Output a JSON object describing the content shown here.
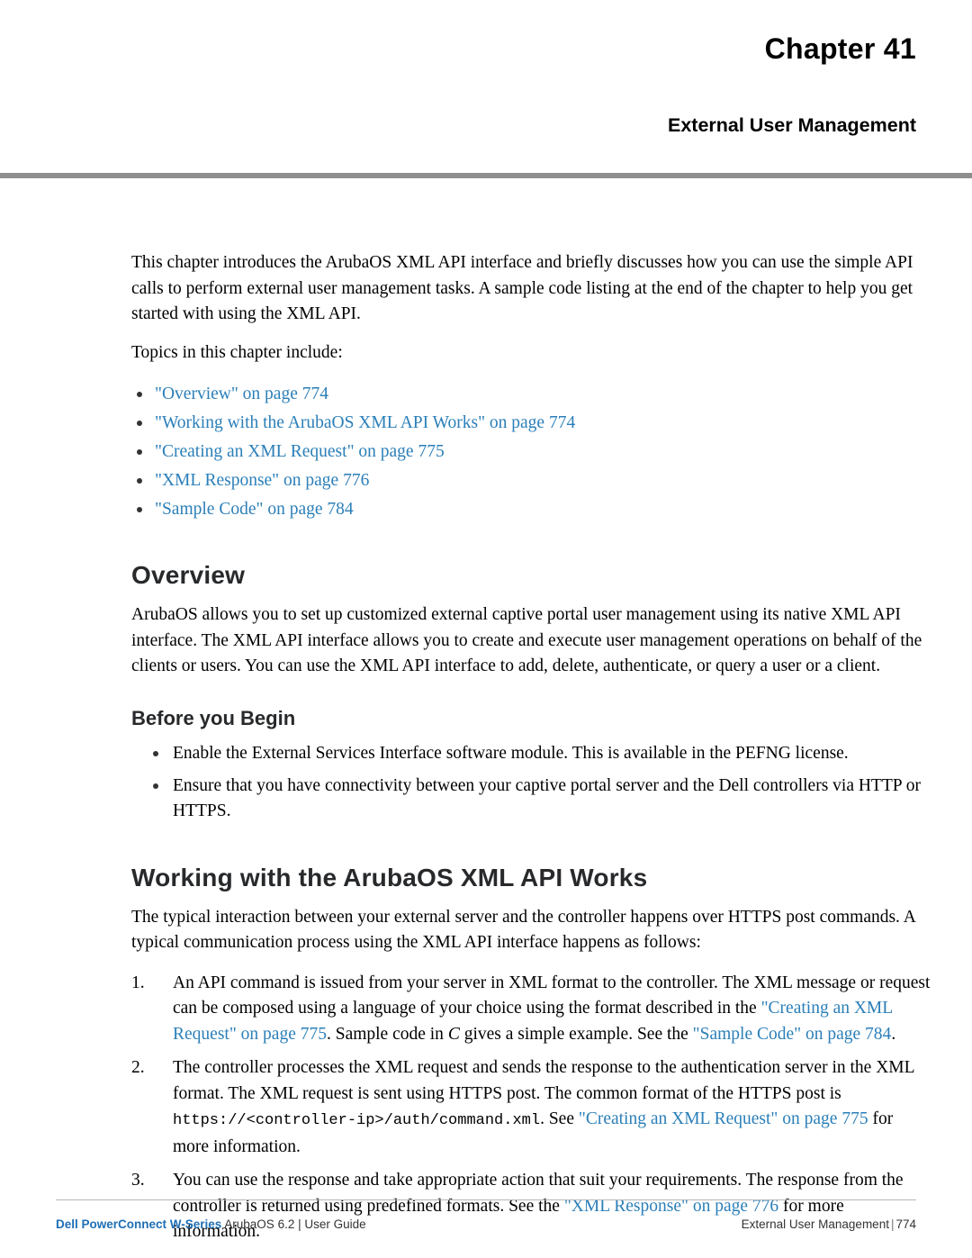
{
  "header": {
    "chapter_title": "Chapter 41",
    "chapter_subtitle": "External User Management"
  },
  "intro": {
    "paragraph": "This chapter introduces the ArubaOS XML API interface and briefly discusses how you can use the simple API calls to perform external user management tasks. A sample code listing at the end of the chapter to help you get started with using the XML API.",
    "topics_lead": "Topics in this chapter include:",
    "topics": [
      "\"Overview\" on page 774",
      "\"Working with the ArubaOS XML API Works\" on page 774",
      "\"Creating an XML Request\" on page 775",
      "\"XML Response\" on page 776",
      "\"Sample Code\" on page 784"
    ]
  },
  "overview": {
    "heading": "Overview",
    "paragraph": "ArubaOS allows you to set up customized external captive portal user management using its native XML API interface. The XML API interface allows you to create and execute user management operations on behalf of the clients or users. You can use the XML API interface to add, delete, authenticate, or query a user or a client."
  },
  "before_you_begin": {
    "heading": "Before you Begin",
    "items": [
      "Enable the External Services Interface software module. This is available in the PEFNG license.",
      "Ensure that you have connectivity between your captive portal server and the Dell controllers via HTTP or HTTPS."
    ]
  },
  "working": {
    "heading": "Working with the ArubaOS XML API Works",
    "paragraph": "The typical interaction between your external server and the controller happens over HTTPS post commands. A typical communication process using the XML API interface happens as follows:",
    "steps": [
      {
        "pre": "An API command is issued from your server in XML format to the controller. The XML message or request can be composed using a language of your choice using the format described in the ",
        "link1": "\"Creating an XML Request\" on page 775",
        "mid": ". Sample code in ",
        "italic": "C",
        "mid2": " gives a simple example. See the ",
        "link2": "\"Sample Code\" on page 784",
        "post": "."
      },
      {
        "pre": "The controller processes the XML request and sends the response to the authentication server in the XML format. The XML request is sent using HTTPS post. The common format of the HTTPS post is ",
        "code": "https://<controller-ip>/auth/command.xml",
        "mid": ". See ",
        "link1": "\"Creating an XML Request\" on page 775",
        "post": " for more information."
      },
      {
        "pre": "You can use the response and take appropriate action that suit your requirements. The response from the controller is returned using predefined formats. See the ",
        "link1": "\"XML Response\" on page 776",
        "post": " for more information."
      }
    ]
  },
  "footer": {
    "left_brand": "Dell PowerConnect W-Series",
    "left_rest": " ArubaOS 6.2 | User Guide",
    "right_label": "External User Management",
    "right_sep": "|",
    "right_page": "774"
  },
  "colors": {
    "link": "#2b7fb8",
    "rule": "#8e8e8e",
    "heading": "#27292b",
    "footer_brand": "#1f6fb5"
  }
}
